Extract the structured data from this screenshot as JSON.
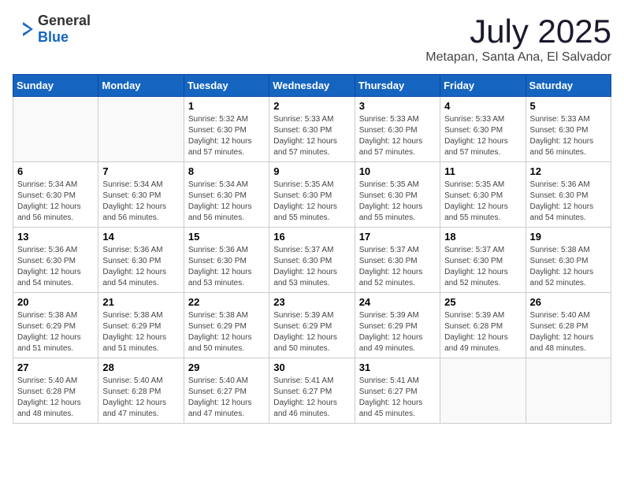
{
  "header": {
    "logo": {
      "general": "General",
      "blue": "Blue"
    },
    "title": "July 2025",
    "location": "Metapan, Santa Ana, El Salvador"
  },
  "weekdays": [
    "Sunday",
    "Monday",
    "Tuesday",
    "Wednesday",
    "Thursday",
    "Friday",
    "Saturday"
  ],
  "weeks": [
    [
      {
        "day": "",
        "sunrise": "",
        "sunset": "",
        "daylight": ""
      },
      {
        "day": "",
        "sunrise": "",
        "sunset": "",
        "daylight": ""
      },
      {
        "day": "1",
        "sunrise": "Sunrise: 5:32 AM",
        "sunset": "Sunset: 6:30 PM",
        "daylight": "Daylight: 12 hours and 57 minutes."
      },
      {
        "day": "2",
        "sunrise": "Sunrise: 5:33 AM",
        "sunset": "Sunset: 6:30 PM",
        "daylight": "Daylight: 12 hours and 57 minutes."
      },
      {
        "day": "3",
        "sunrise": "Sunrise: 5:33 AM",
        "sunset": "Sunset: 6:30 PM",
        "daylight": "Daylight: 12 hours and 57 minutes."
      },
      {
        "day": "4",
        "sunrise": "Sunrise: 5:33 AM",
        "sunset": "Sunset: 6:30 PM",
        "daylight": "Daylight: 12 hours and 57 minutes."
      },
      {
        "day": "5",
        "sunrise": "Sunrise: 5:33 AM",
        "sunset": "Sunset: 6:30 PM",
        "daylight": "Daylight: 12 hours and 56 minutes."
      }
    ],
    [
      {
        "day": "6",
        "sunrise": "Sunrise: 5:34 AM",
        "sunset": "Sunset: 6:30 PM",
        "daylight": "Daylight: 12 hours and 56 minutes."
      },
      {
        "day": "7",
        "sunrise": "Sunrise: 5:34 AM",
        "sunset": "Sunset: 6:30 PM",
        "daylight": "Daylight: 12 hours and 56 minutes."
      },
      {
        "day": "8",
        "sunrise": "Sunrise: 5:34 AM",
        "sunset": "Sunset: 6:30 PM",
        "daylight": "Daylight: 12 hours and 56 minutes."
      },
      {
        "day": "9",
        "sunrise": "Sunrise: 5:35 AM",
        "sunset": "Sunset: 6:30 PM",
        "daylight": "Daylight: 12 hours and 55 minutes."
      },
      {
        "day": "10",
        "sunrise": "Sunrise: 5:35 AM",
        "sunset": "Sunset: 6:30 PM",
        "daylight": "Daylight: 12 hours and 55 minutes."
      },
      {
        "day": "11",
        "sunrise": "Sunrise: 5:35 AM",
        "sunset": "Sunset: 6:30 PM",
        "daylight": "Daylight: 12 hours and 55 minutes."
      },
      {
        "day": "12",
        "sunrise": "Sunrise: 5:36 AM",
        "sunset": "Sunset: 6:30 PM",
        "daylight": "Daylight: 12 hours and 54 minutes."
      }
    ],
    [
      {
        "day": "13",
        "sunrise": "Sunrise: 5:36 AM",
        "sunset": "Sunset: 6:30 PM",
        "daylight": "Daylight: 12 hours and 54 minutes."
      },
      {
        "day": "14",
        "sunrise": "Sunrise: 5:36 AM",
        "sunset": "Sunset: 6:30 PM",
        "daylight": "Daylight: 12 hours and 54 minutes."
      },
      {
        "day": "15",
        "sunrise": "Sunrise: 5:36 AM",
        "sunset": "Sunset: 6:30 PM",
        "daylight": "Daylight: 12 hours and 53 minutes."
      },
      {
        "day": "16",
        "sunrise": "Sunrise: 5:37 AM",
        "sunset": "Sunset: 6:30 PM",
        "daylight": "Daylight: 12 hours and 53 minutes."
      },
      {
        "day": "17",
        "sunrise": "Sunrise: 5:37 AM",
        "sunset": "Sunset: 6:30 PM",
        "daylight": "Daylight: 12 hours and 52 minutes."
      },
      {
        "day": "18",
        "sunrise": "Sunrise: 5:37 AM",
        "sunset": "Sunset: 6:30 PM",
        "daylight": "Daylight: 12 hours and 52 minutes."
      },
      {
        "day": "19",
        "sunrise": "Sunrise: 5:38 AM",
        "sunset": "Sunset: 6:30 PM",
        "daylight": "Daylight: 12 hours and 52 minutes."
      }
    ],
    [
      {
        "day": "20",
        "sunrise": "Sunrise: 5:38 AM",
        "sunset": "Sunset: 6:29 PM",
        "daylight": "Daylight: 12 hours and 51 minutes."
      },
      {
        "day": "21",
        "sunrise": "Sunrise: 5:38 AM",
        "sunset": "Sunset: 6:29 PM",
        "daylight": "Daylight: 12 hours and 51 minutes."
      },
      {
        "day": "22",
        "sunrise": "Sunrise: 5:38 AM",
        "sunset": "Sunset: 6:29 PM",
        "daylight": "Daylight: 12 hours and 50 minutes."
      },
      {
        "day": "23",
        "sunrise": "Sunrise: 5:39 AM",
        "sunset": "Sunset: 6:29 PM",
        "daylight": "Daylight: 12 hours and 50 minutes."
      },
      {
        "day": "24",
        "sunrise": "Sunrise: 5:39 AM",
        "sunset": "Sunset: 6:29 PM",
        "daylight": "Daylight: 12 hours and 49 minutes."
      },
      {
        "day": "25",
        "sunrise": "Sunrise: 5:39 AM",
        "sunset": "Sunset: 6:28 PM",
        "daylight": "Daylight: 12 hours and 49 minutes."
      },
      {
        "day": "26",
        "sunrise": "Sunrise: 5:40 AM",
        "sunset": "Sunset: 6:28 PM",
        "daylight": "Daylight: 12 hours and 48 minutes."
      }
    ],
    [
      {
        "day": "27",
        "sunrise": "Sunrise: 5:40 AM",
        "sunset": "Sunset: 6:28 PM",
        "daylight": "Daylight: 12 hours and 48 minutes."
      },
      {
        "day": "28",
        "sunrise": "Sunrise: 5:40 AM",
        "sunset": "Sunset: 6:28 PM",
        "daylight": "Daylight: 12 hours and 47 minutes."
      },
      {
        "day": "29",
        "sunrise": "Sunrise: 5:40 AM",
        "sunset": "Sunset: 6:27 PM",
        "daylight": "Daylight: 12 hours and 47 minutes."
      },
      {
        "day": "30",
        "sunrise": "Sunrise: 5:41 AM",
        "sunset": "Sunset: 6:27 PM",
        "daylight": "Daylight: 12 hours and 46 minutes."
      },
      {
        "day": "31",
        "sunrise": "Sunrise: 5:41 AM",
        "sunset": "Sunset: 6:27 PM",
        "daylight": "Daylight: 12 hours and 45 minutes."
      },
      {
        "day": "",
        "sunrise": "",
        "sunset": "",
        "daylight": ""
      },
      {
        "day": "",
        "sunrise": "",
        "sunset": "",
        "daylight": ""
      }
    ]
  ]
}
